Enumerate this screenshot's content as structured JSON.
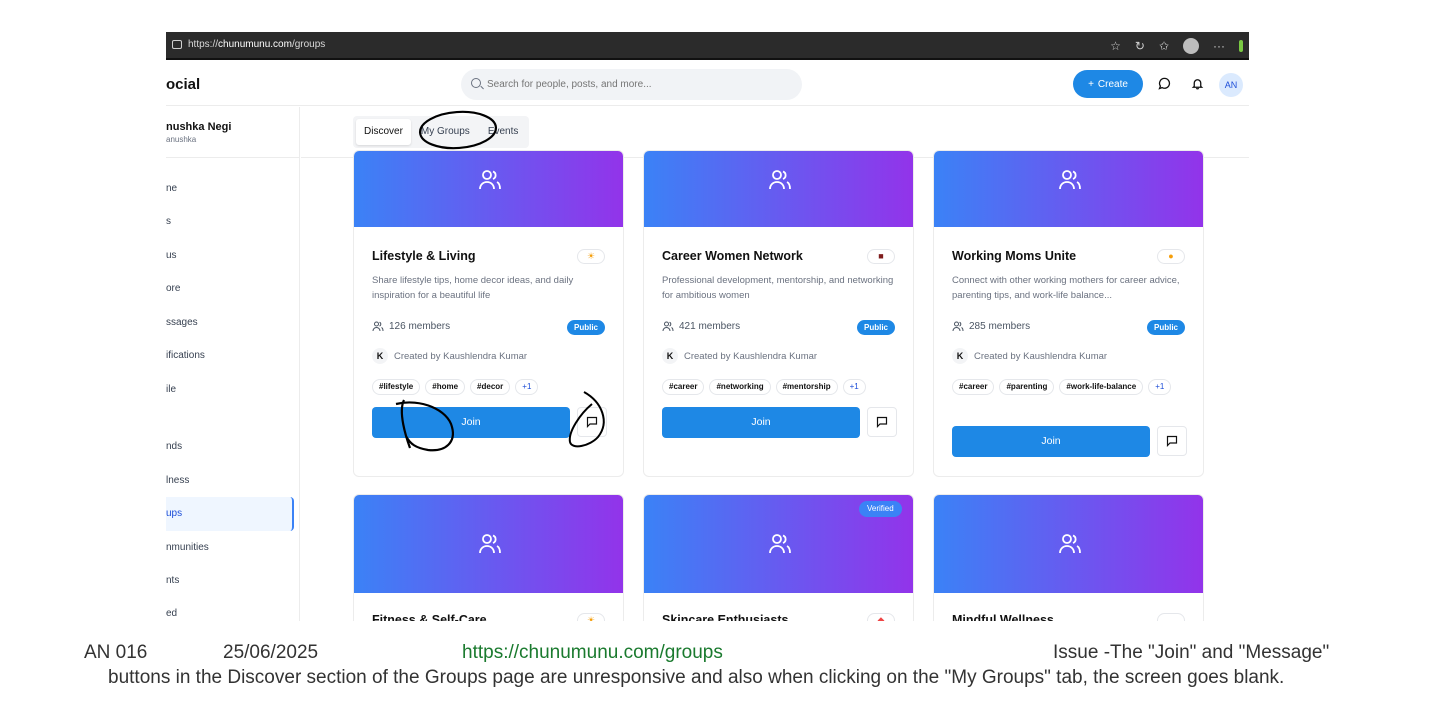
{
  "browser": {
    "url_prefix": "https://",
    "url_domain": "chunumunu.com",
    "url_path": "/groups",
    "icons": [
      "star-icon",
      "refresh-icon",
      "favorites-icon",
      "profile-icon",
      "more-icon"
    ]
  },
  "header": {
    "logo": "ocial",
    "search_placeholder": "Search for people, posts, and more...",
    "create_label": "Create",
    "avatar_initials": "AN"
  },
  "sidebar": {
    "user_name": "nushka Negi",
    "user_handle": "anushka",
    "items": [
      {
        "label": "ne"
      },
      {
        "label": "s"
      },
      {
        "label": "us"
      },
      {
        "label": "ore"
      },
      {
        "label": "ssages"
      },
      {
        "label": "ifications"
      },
      {
        "label": "ile"
      },
      {
        "label": "nds"
      },
      {
        "label": "lness"
      },
      {
        "label": "ups"
      },
      {
        "label": "nmunities"
      },
      {
        "label": "nts"
      },
      {
        "label": "ed"
      }
    ],
    "active_index": 9
  },
  "tabs": [
    {
      "label": "Discover",
      "active": true
    },
    {
      "label": "My Groups",
      "active": false
    },
    {
      "label": "Events",
      "active": false
    }
  ],
  "groups": [
    {
      "title": "Lifestyle & Living",
      "emoji": "☀",
      "emoji_color": "#f59e0b",
      "description": "Share lifestyle tips, home decor ideas, and daily inspiration for a beautiful life",
      "members": "126 members",
      "visibility": "Public",
      "creator_initial": "K",
      "creator": "Created by Kaushlendra Kumar",
      "tags": [
        "#lifestyle",
        "#home",
        "#decor"
      ],
      "more_tags": "+1",
      "join_label": "Join"
    },
    {
      "title": "Career Women Network",
      "emoji": "■",
      "emoji_color": "#7f1d1d",
      "description": "Professional development, mentorship, and networking for ambitious women",
      "members": "421 members",
      "visibility": "Public",
      "creator_initial": "K",
      "creator": "Created by Kaushlendra Kumar",
      "tags": [
        "#career",
        "#networking",
        "#mentorship"
      ],
      "more_tags": "+1",
      "join_label": "Join"
    },
    {
      "title": "Working Moms Unite",
      "emoji": "●",
      "emoji_color": "#f59e0b",
      "description": "Connect with other working mothers for career advice, parenting tips, and work-life balance...",
      "members": "285 members",
      "visibility": "Public",
      "creator_initial": "K",
      "creator": "Created by Kaushlendra Kumar",
      "tags": [
        "#career",
        "#parenting",
        "#work-life-balance"
      ],
      "more_tags": "+1",
      "join_label": "Join"
    },
    {
      "title": "Fitness & Self-Care",
      "emoji": "☀",
      "emoji_color": "#f59e0b",
      "verified": ""
    },
    {
      "title": "Skincare Enthusiasts",
      "emoji": "◆",
      "emoji_color": "#ef4444",
      "verified": "Verified"
    },
    {
      "title": "Mindful Wellness",
      "emoji": "",
      "emoji_color": "#9ca3af",
      "verified": ""
    }
  ],
  "caption": {
    "id": "AN 016",
    "date": "25/06/2025",
    "link": "https://chunumunu.com/groups",
    "issue_line1": "Issue -The \"Join\" and \"Message\"",
    "issue_line2": "buttons in the Discover section of the Groups page are unresponsive and also when clicking on the \"My Groups\" tab, the screen goes blank."
  },
  "colors": {
    "accent": "#1e88e5",
    "banner_start": "#3b82f6",
    "banner_end": "#9333ea",
    "annotation": "#000000",
    "caption_link": "#1a7a2e"
  }
}
